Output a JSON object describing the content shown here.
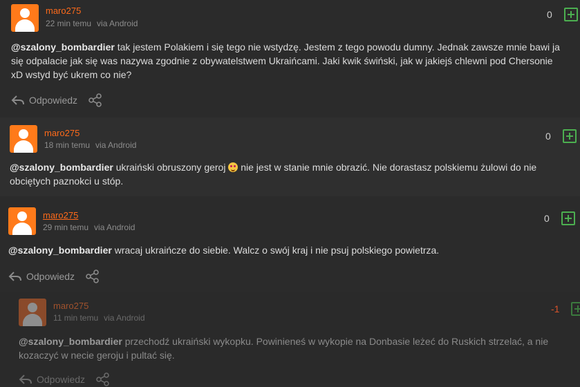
{
  "comments": [
    {
      "username": "maro275",
      "time": "22 min temu",
      "via": "via Android",
      "votes": "0",
      "mention": "@szalony_bombardier",
      "lines": [
        " tak jestem Polakiem i się tego nie wstydzę. Jestem z tego powodu dumny. Jednak zawsze mnie bawi ja",
        "się odpalacie jak się was nazywa zgodnie z obywatelstwem Ukraińcami. Jaki kwik świński, jak w jakiejś chlewni pod Chersonie",
        "xD wstyd być ukrem co nie?"
      ],
      "reply_label": "Odpowiedz"
    },
    {
      "username": "maro275",
      "time": "18 min temu",
      "via": "via Android",
      "votes": "0",
      "mention": "@szalony_bombardier",
      "line1_before_emoji": " ukraiński obruszony geroj ",
      "line1_after_emoji": " nie jest w stanie mnie obrazić. Nie dorastasz polskiemu żulowi do nie",
      "line2": "obciętych paznokci u stóp."
    },
    {
      "username": "maro275",
      "time": "29 min temu",
      "via": "via Android",
      "votes": "0",
      "mention": "@szalony_bombardier",
      "line1": " wracaj ukraińcze do siebie. Walcz o swój kraj i nie psuj polskiego powietrza.",
      "reply_label": "Odpowiedz"
    },
    {
      "username": "maro275",
      "time": "11 min temu",
      "via": "via Android",
      "votes": "-1",
      "mention": "@szalony_bombardier",
      "line1": " przechodź ukraiński wykopku. Powinieneś w wykopie na Donbasie leżeć do Ruskich strzelać, a nie",
      "line2": "kozaczyć w necie geroju i pultać się.",
      "reply_label": "Odpowiedz"
    }
  ],
  "colors": {
    "accent": "#ff6a1a",
    "plus": "#4caf50",
    "negative": "#d9532b"
  }
}
